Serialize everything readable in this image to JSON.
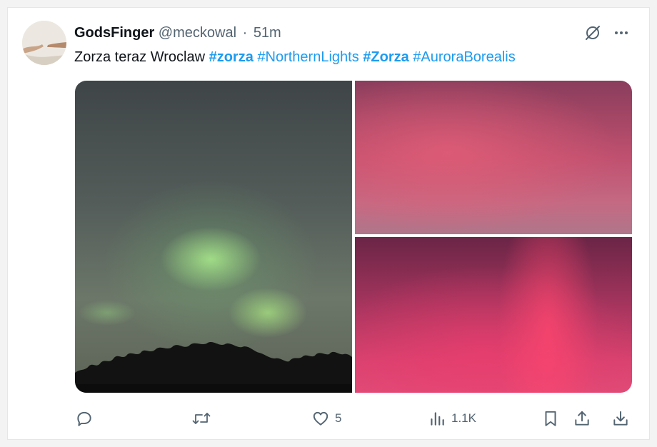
{
  "tweet": {
    "display_name": "GodsFinger",
    "handle": "@meckowal",
    "separator": "·",
    "time": "51m",
    "text_parts": [
      {
        "text": "Zorza teraz Wroclaw ",
        "type": "plain"
      },
      {
        "text": "#zorza",
        "type": "hashtag-bold"
      },
      {
        "text": " ",
        "type": "plain"
      },
      {
        "text": "#NorthernLights",
        "type": "hashtag"
      },
      {
        "text": " ",
        "type": "plain"
      },
      {
        "text": "#Zorza",
        "type": "hashtag-bold"
      },
      {
        "text": " ",
        "type": "plain"
      },
      {
        "text": "#AuroraBorealis",
        "type": "hashtag"
      }
    ]
  },
  "media": {
    "images": [
      {
        "subject": "green aurora over tree silhouette"
      },
      {
        "subject": "red aurora sky"
      },
      {
        "subject": "red aurora sky"
      }
    ]
  },
  "actions": {
    "reply": {
      "icon": "reply-icon",
      "count": ""
    },
    "repost": {
      "icon": "repost-icon",
      "count": ""
    },
    "like": {
      "icon": "heart-icon",
      "count": "5"
    },
    "views": {
      "icon": "views-icon",
      "count": "1.1K"
    },
    "bookmark": {
      "icon": "bookmark-icon"
    },
    "share": {
      "icon": "share-icon"
    },
    "download": {
      "icon": "download-icon"
    }
  },
  "colors": {
    "text": "#0f1419",
    "secondary": "#536471",
    "link": "#1d9bf0",
    "background": "#ffffff"
  }
}
